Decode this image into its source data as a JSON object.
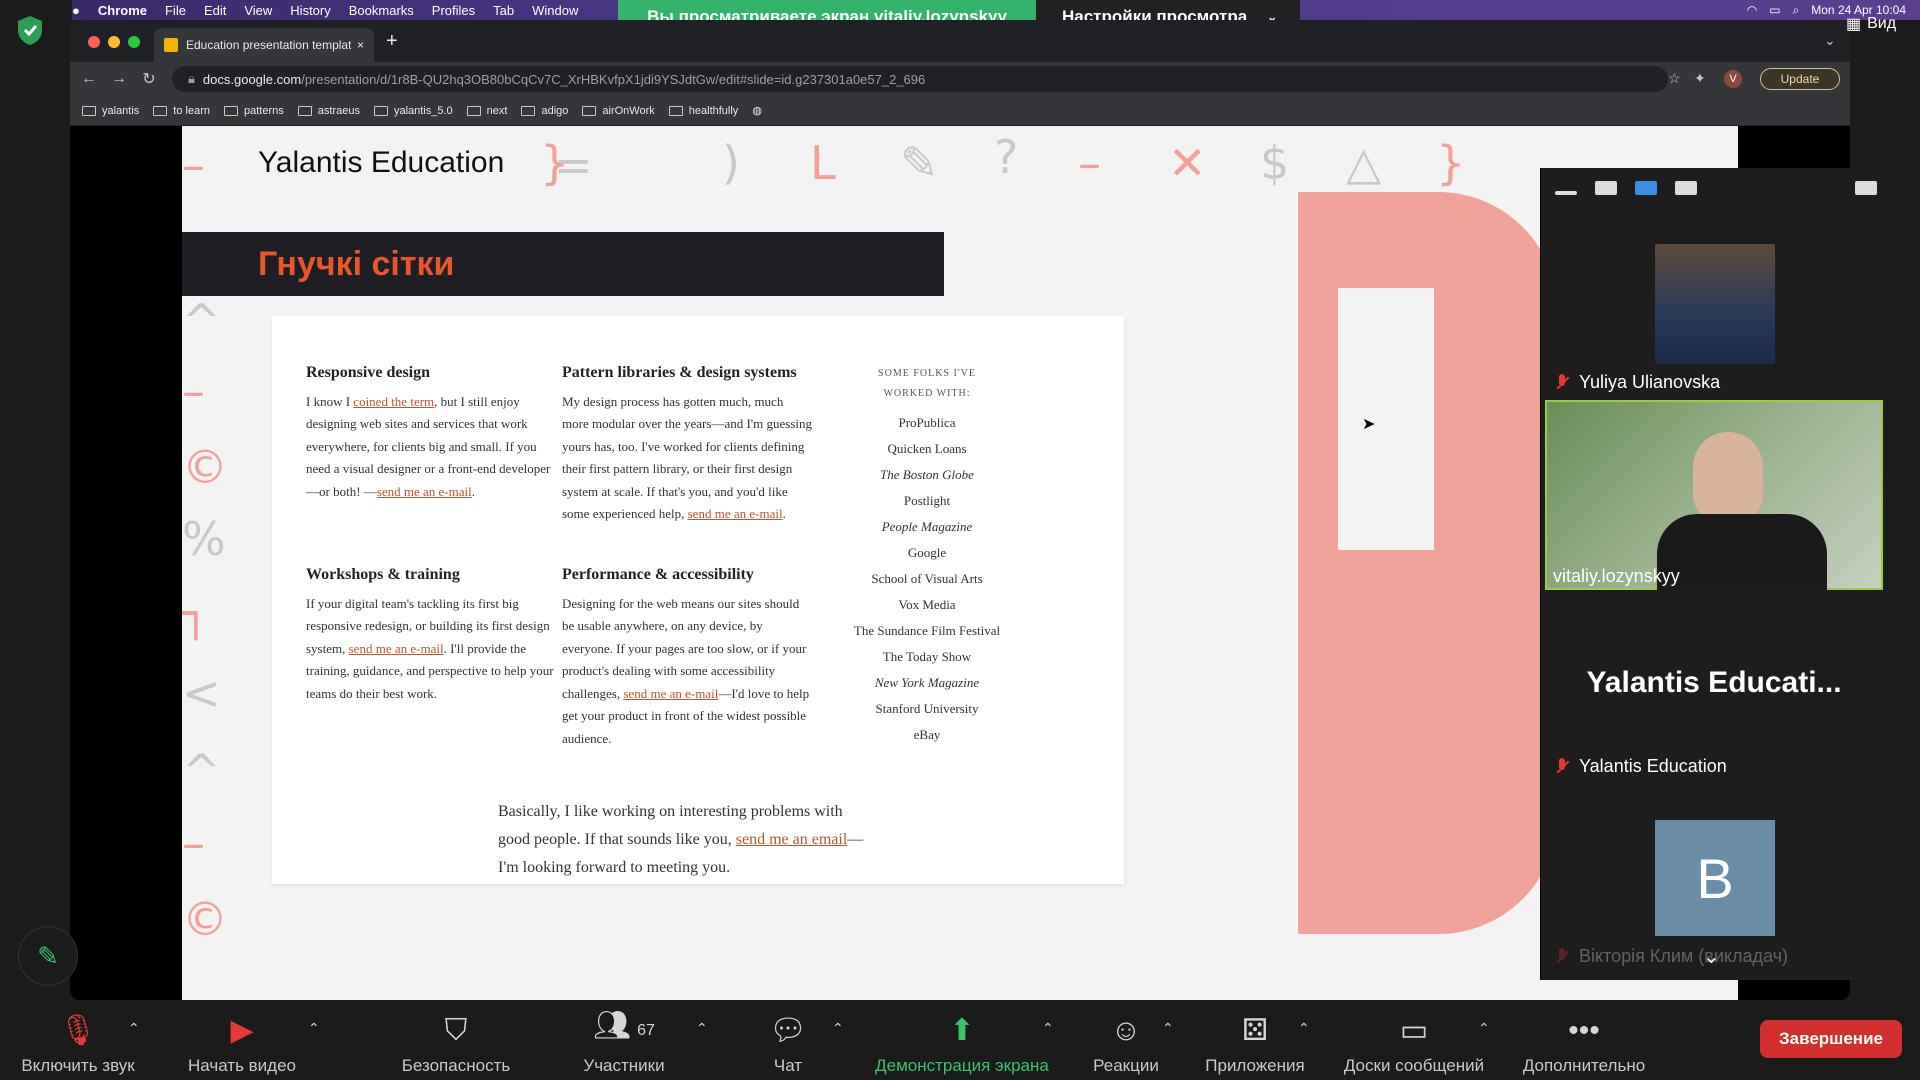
{
  "menubar": {
    "apple": "",
    "items": [
      "Chrome",
      "File",
      "Edit",
      "View",
      "History",
      "Bookmarks",
      "Profiles",
      "Tab",
      "Window"
    ],
    "clock": "Mon 24 Apr  10:04"
  },
  "zoom_banner": {
    "sharing_text": "Вы просматриваете экран vitaliy.lozynskyy",
    "view_options": "Настройки просмотра",
    "view_label": "Вид"
  },
  "browser": {
    "tab_title": "Education presentation templat",
    "url_host": "docs.google.com",
    "url_path": "/presentation/d/1r8B-QU2hq3OB80bCqCv7C_XrHBKvfpX1jdi9YSJdtGw/edit#slide=id.g237301a0e57_2_696",
    "update_label": "Update",
    "profile_initial": "V",
    "bookmarks": [
      "yalantis",
      "to learn",
      "patterns",
      "astraeus",
      "yalantis_5.0",
      "next",
      "adigo",
      "airOnWork",
      "healthfully"
    ]
  },
  "slide": {
    "logo": "Yalantis Education",
    "title": "Гнучкі сітки",
    "card": {
      "col1": [
        {
          "heading": "Responsive design",
          "pre": "I know I ",
          "link": "coined the term",
          "post": ", but I still enjoy designing web sites and services that work everywhere, for clients big and small. If you need a visual designer or a front-end developer—or both! —",
          "link2": "send me an e-mail",
          "end": "."
        },
        {
          "heading": "Workshops & training",
          "pre": "If your digital team's tackling its first big responsive redesign, or building its first design system, ",
          "link": "send me an e-mail",
          "post": ". I'll provide the training, guidance, and perspective to help your teams do their best work."
        }
      ],
      "col2": [
        {
          "heading": "Pattern libraries & design systems",
          "pre": "My design process has gotten much, much more modular over the years—and I'm guessing yours has, too. I've worked for clients defining their first pattern library, or their first design system at scale. If that's you, and you'd like some experienced help, ",
          "link": "send me an e-mail",
          "post": "."
        },
        {
          "heading": "Performance & accessibility",
          "pre": "Designing for the web means our sites should be usable anywhere, on any device, by everyone. If your pages are too slow, or if your product's dealing with some accessibility challenges, ",
          "link": "send me an e-mail",
          "post": "—I'd love to help get your product in front of the widest possible audience."
        }
      ],
      "folks_caption": "SOME FOLKS I'VE WORKED WITH:",
      "folks": [
        "ProPublica",
        "Quicken Loans",
        "The Boston Globe",
        "Postlight",
        "People Magazine",
        "Google",
        "School of Visual Arts",
        "Vox Media",
        "The Sundance Film Festival",
        "The Today Show",
        "New York Magazine",
        "Stanford University",
        "eBay"
      ],
      "closing_pre": "Basically, I like working on interesting problems with good people. If that sounds like you, ",
      "closing_link": "send me an email",
      "closing_post": "—I'm looking forward to meeting you."
    }
  },
  "participants": [
    {
      "name": "Yuliya Ulianovska",
      "muted": true
    },
    {
      "name": "vitaliy.lozynskyy",
      "muted": false
    },
    {
      "name": "Yalantis Education",
      "muted": true,
      "tile_text": "Yalantis  Educati..."
    },
    {
      "name": "Вікторія Клим (викладач)",
      "muted": true,
      "avatar_letter": "B"
    }
  ],
  "toolbar": {
    "unmute": "Включить звук",
    "start_video": "Начать видео",
    "security": "Безопасность",
    "participants": "Участники",
    "participants_count": "67",
    "chat": "Чат",
    "share_screen": "Демонстрация экрана",
    "reactions": "Реакции",
    "apps": "Приложения",
    "whiteboards": "Доски сообщений",
    "more": "Дополнительно",
    "end": "Завершение"
  },
  "colors": {
    "accent_orange": "#e8562a",
    "link": "#c0532f",
    "share_green": "#35b26b",
    "end_red": "#d32f2f",
    "deco_pink": "#f1a39b"
  }
}
